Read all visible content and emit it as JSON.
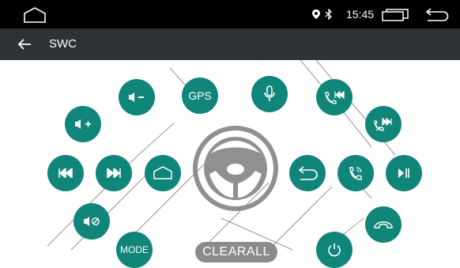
{
  "status_bar": {
    "time": "15:45",
    "icons": [
      "home-icon",
      "location-icon",
      "bluetooth-icon",
      "recents-icon",
      "back-icon"
    ]
  },
  "app_bar": {
    "title": "SWC",
    "back_icon": "arrow-left-icon"
  },
  "buttons": {
    "gps_label": "GPS",
    "mode_label": "MODE",
    "clearall_label": "CLEARALL"
  },
  "icons": [
    "volume-up-icon",
    "volume-down-icon",
    "gps-icon",
    "mic-icon",
    "call-prev-icon",
    "call-next-icon",
    "prev-track-icon",
    "next-track-icon",
    "home-icon",
    "back-icon",
    "answer-call-icon",
    "play-pause-icon",
    "mute-icon",
    "hang-up-icon",
    "power-icon",
    "steering-wheel-icon"
  ],
  "colors": {
    "accent": "#10857a",
    "status_bar": "#000000",
    "app_bar": "#2e3236",
    "clearall": "#8b8b8b",
    "wheel": "#909090"
  }
}
